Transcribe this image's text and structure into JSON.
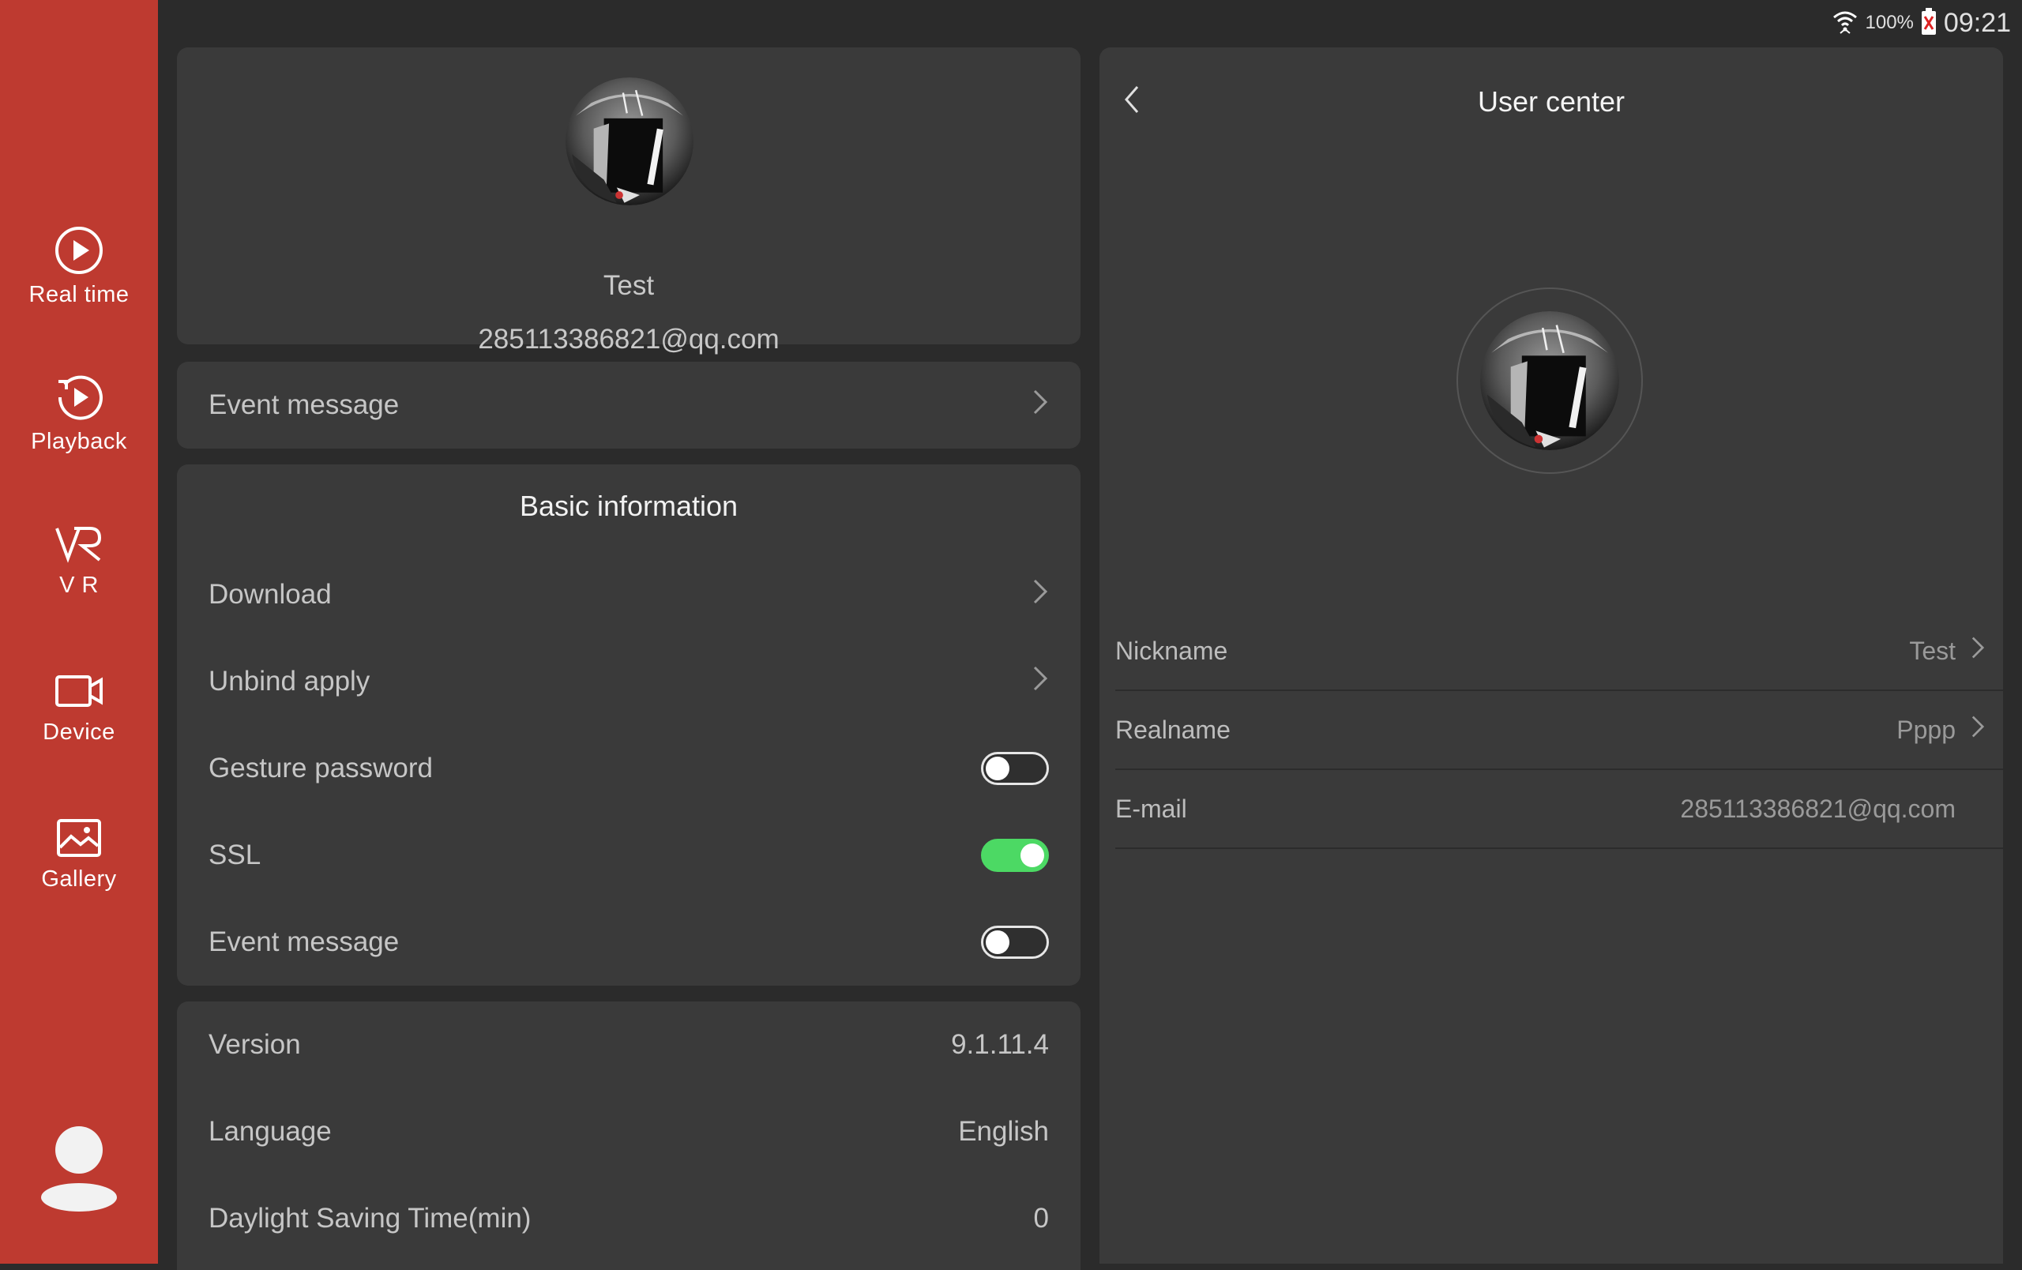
{
  "status_bar": {
    "battery": "100%",
    "time": "09:21"
  },
  "sidebar": {
    "items": [
      {
        "label": "Real time",
        "icon": "play-circle-icon"
      },
      {
        "label": "Playback",
        "icon": "playback-icon"
      },
      {
        "label": "V R",
        "icon": "vr-icon"
      },
      {
        "label": "Device",
        "icon": "camera-icon"
      },
      {
        "label": "Gallery",
        "icon": "gallery-icon"
      }
    ],
    "user_icon": "user-icon"
  },
  "profile": {
    "name": "Test",
    "email": "285113386821@qq.com"
  },
  "event_message_row": {
    "label": "Event message"
  },
  "basic_info": {
    "title": "Basic information",
    "rows": [
      {
        "label": "Download",
        "type": "link"
      },
      {
        "label": "Unbind apply",
        "type": "link"
      },
      {
        "label": "Gesture password",
        "type": "toggle",
        "on": false
      },
      {
        "label": "SSL",
        "type": "toggle",
        "on": true
      },
      {
        "label": "Event message",
        "type": "toggle",
        "on": false
      }
    ]
  },
  "app_info": {
    "rows": [
      {
        "label": "Version",
        "value": "9.1.11.4"
      },
      {
        "label": "Language",
        "value": "English"
      },
      {
        "label": "Daylight Saving Time(min)",
        "value": "0"
      }
    ]
  },
  "user_center": {
    "title": "User center",
    "rows": [
      {
        "label": "Nickname",
        "value": "Test"
      },
      {
        "label": "Realname",
        "value": "Pppp"
      },
      {
        "label": "E-mail",
        "value": "285113386821@qq.com"
      }
    ]
  },
  "colors": {
    "sidebar": "#be3a30",
    "toggle_on": "#4cd964",
    "card": "#3a3a3a",
    "background": "#2b2b2b"
  }
}
